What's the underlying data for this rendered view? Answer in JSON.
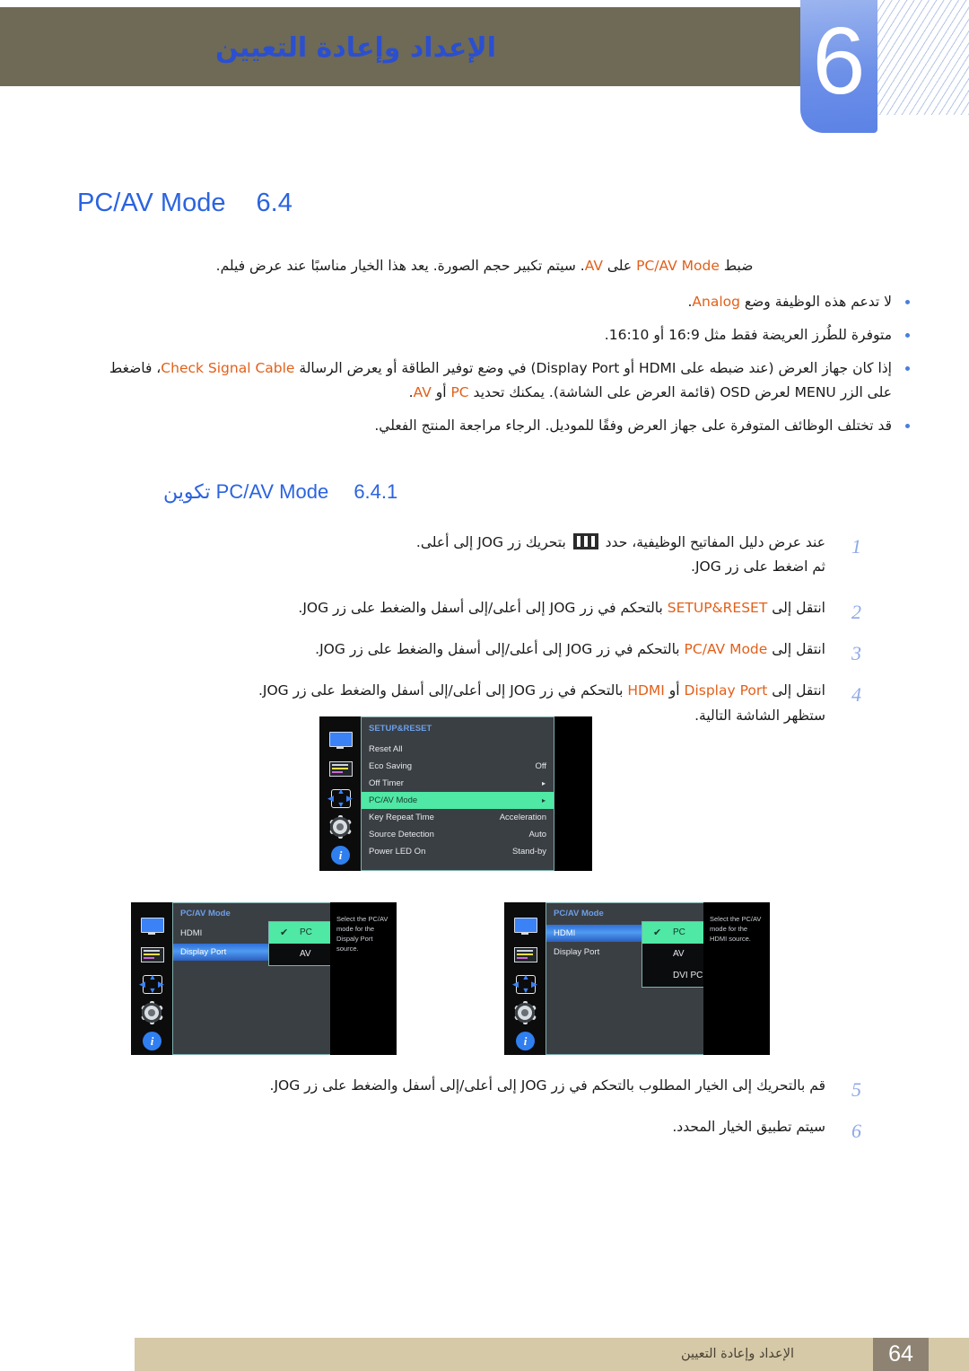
{
  "header": {
    "chapter_number": "6",
    "chapter_title": "الإعداد وإعادة التعيين",
    "band_color": "#6e6a55",
    "tab_color": "#6d90e8",
    "title_color": "#2b4fd0"
  },
  "section": {
    "number": "6.4",
    "title": "PC/AV Mode",
    "intro": "ضبط PC/AV Mode على AV. سيتم تكبير حجم الصورة. يعد هذا الخيار مناسبًا عند عرض فيلم.",
    "notes": [
      "لا تدعم هذه الوظيفة وضع Analog.",
      "متوفرة للطُرز العريضة فقط مثل 16:9 أو 16:10.",
      "إذا كان جهاز العرض (عند ضبطه على HDMI أو Display Port) في وضع توفير الطاقة أو يعرض الرسالة Check Signal Cable، فاضغط على الزر MENU لعرض OSD (قائمة العرض على الشاشة). يمكنك تحديد PC أو AV.",
      "قد تختلف الوظائف المتوفرة على جهاز العرض وفقًا للموديل. الرجاء مراجعة المنتج الفعلي."
    ]
  },
  "subsection": {
    "number": "6.4.1",
    "title_en": "PC/AV Mode",
    "title_ar": "تكوين",
    "steps": [
      {
        "n": "1",
        "line1_a": "عند عرض دليل المفاتيح الوظيفية، حدد",
        "line1_b": "بتحريك زر JOG إلى أعلى.",
        "line2": "ثم اضغط على زر JOG."
      },
      {
        "n": "2",
        "text": "انتقل إلى SETUP&RESET بالتحكم في زر JOG إلى أعلى/إلى أسفل والضغط على زر JOG."
      },
      {
        "n": "3",
        "text": "انتقل إلى PC/AV Mode بالتحكم في زر JOG إلى أعلى/إلى أسفل والضغط على زر JOG."
      },
      {
        "n": "4",
        "line1": "انتقل إلى Display Port أو HDMI بالتحكم في زر JOG إلى أعلى/إلى أسفل والضغط على زر JOG.",
        "line2": "ستظهر الشاشة التالية."
      },
      {
        "n": "5",
        "text": "قم بالتحريك إلى الخيار المطلوب بالتحكم في زر JOG إلى أعلى/إلى أسفل والضغط على زر JOG."
      },
      {
        "n": "6",
        "text": "سيتم تطبيق الخيار المحدد."
      }
    ]
  },
  "osd": {
    "rail_icons": [
      "monitor-icon",
      "color-list-icon",
      "move-arrows-icon",
      "gear-icon",
      "info-icon"
    ],
    "highlight_green": "#4fe8a5",
    "highlight_blue": "#3b82f6",
    "top_menu": {
      "title": "SETUP&RESET",
      "rows": [
        {
          "label": "Reset All",
          "value": "",
          "arrow": "",
          "state": ""
        },
        {
          "label": "Eco Saving",
          "value": "Off",
          "arrow": "",
          "state": ""
        },
        {
          "label": "Off Timer",
          "value": "",
          "arrow": "▸",
          "state": ""
        },
        {
          "label": "PC/AV Mode",
          "value": "",
          "arrow": "▸",
          "state": "green"
        },
        {
          "label": "Key Repeat Time",
          "value": "Acceleration",
          "arrow": "",
          "state": ""
        },
        {
          "label": "Source Detection",
          "value": "Auto",
          "arrow": "",
          "state": ""
        },
        {
          "label": "Power LED On",
          "value": "Stand-by",
          "arrow": "",
          "state": ""
        }
      ]
    },
    "left_menu": {
      "title": "PC/AV Mode",
      "rows": [
        {
          "label": "HDMI",
          "state": ""
        },
        {
          "label": "Display Port",
          "state": "blue"
        }
      ],
      "submenu": [
        {
          "label": "PC",
          "selected": true,
          "check": "✔"
        },
        {
          "label": "AV",
          "selected": false,
          "check": ""
        }
      ],
      "hint": "Select the PC/AV mode for the Dispaly Port source."
    },
    "right_menu": {
      "title": "PC/AV Mode",
      "rows": [
        {
          "label": "HDMI",
          "state": "blue"
        },
        {
          "label": "Display Port",
          "state": ""
        }
      ],
      "submenu": [
        {
          "label": "PC",
          "selected": true,
          "check": "✔"
        },
        {
          "label": "AV",
          "selected": false,
          "check": ""
        },
        {
          "label": "DVI PC",
          "selected": false,
          "check": ""
        }
      ],
      "hint": "Select the PC/AV mode for the HDMI source."
    }
  },
  "footer": {
    "page_number": "64",
    "text": "الإعداد وإعادة التعيين",
    "bar_color": "#d5c9a8",
    "num_bg": "#8e8372"
  }
}
